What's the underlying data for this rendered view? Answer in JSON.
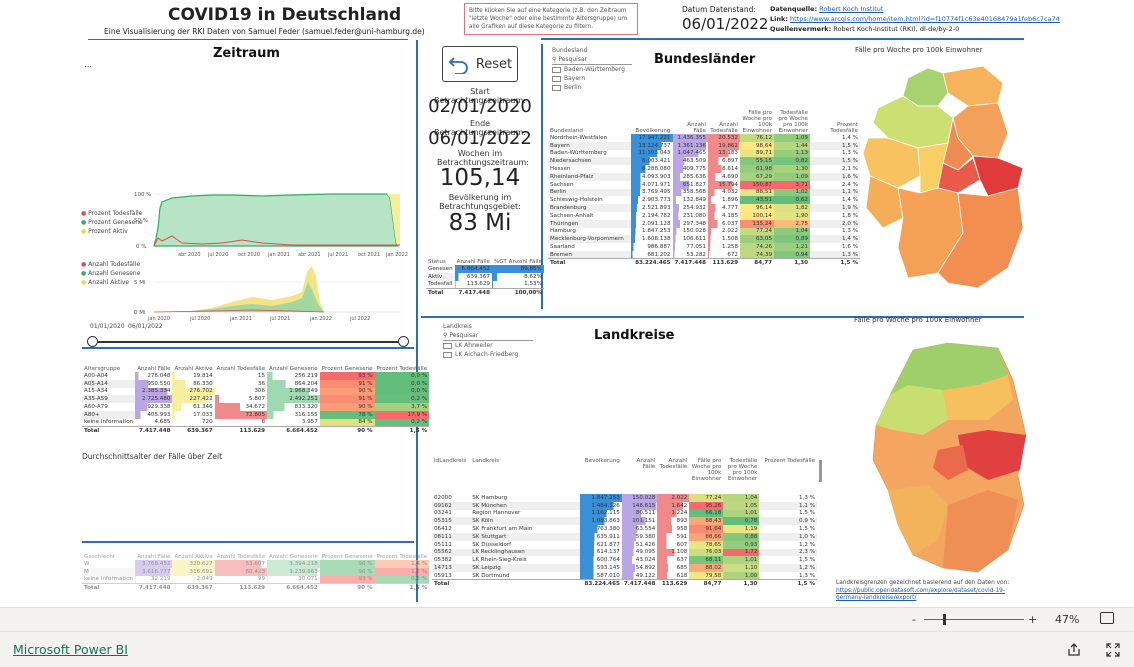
{
  "header": {
    "title": "COVID19 in Deutschland",
    "subtitle": "Eine Visualisierung der RKI Daten von Samuel Feder (samuel.feder@uni-hamburg.de)",
    "notice": "Bitte klicken Sie auf eine Kategorie (z.B. den Zeitraum \"letzte Woche\" oder eine bestimmte Altersgruppe) um alle Grafiken auf diese Kategorie zu filtern.",
    "datenstand_label": "Datum Datenstand:",
    "datenstand_value": "06/01/2022",
    "quelle_label": "Datenquelle:",
    "quelle_value": "Robert Koch Institut",
    "link_label": "Link:",
    "link_value": "https://www.arcgis.com/home/item.html?id=f10774f1c63e40168479a1feb6c7ca74",
    "vermerk_label": "Quellenvermerk:",
    "vermerk_value": "Robert Koch-Institut (RKI), dl-de/by-2-0"
  },
  "zeitraum": {
    "title": "Zeitraum",
    "legend1": [
      "Prozent Todesfälle",
      "Prozent Genesene",
      "Prozent Aktiv"
    ],
    "legend2": [
      "Anzahl Todesfälle",
      "Anzahl Genesene",
      "Anzahl Aktive"
    ],
    "chart1_yticks": [
      "100 %",
      "50 %",
      "0 %"
    ],
    "chart1_xticks": [
      "abr 2020",
      "jul 2020",
      "oct 2020",
      "jan 2021",
      "abr 2021",
      "jul 2021",
      "oct 2021",
      "jan 2022"
    ],
    "chart2_yticks": [
      "5 Mi",
      "0 Mi"
    ],
    "chart2_xticks": [
      "jan 2020",
      "jul 2020",
      "jan 2021",
      "jul 2021",
      "jan 2022",
      "jul 2022"
    ],
    "slider_start": "01/01/2020",
    "slider_end": "06/01/2022",
    "avg_age_title": "Durchschnittsalter der Fälle über Zeit"
  },
  "controls": {
    "reset_label": "Reset",
    "start_label": "Start Betrachtungszeitraum:",
    "start_value": "02/01/2020",
    "end_label": "Ende Betrachtungszeitraum:",
    "end_value": "06/01/2022",
    "weeks_label": "Wochen im Betrachtungszeitraum:",
    "weeks_value": "105,14",
    "pop_label": "Bevölkerung im Betrachtungsgebiet:",
    "pop_value": "83 Mi"
  },
  "status_table": {
    "headers": [
      "Status",
      "Anzahl Fälle",
      "%GT Anzahl Fälle"
    ],
    "rows": [
      [
        "Genesen",
        "6.664.452",
        "89,85%"
      ],
      [
        "Aktiv",
        "639.367",
        "8,62%"
      ],
      [
        "Todesfall",
        "113.629",
        "1,53%"
      ]
    ],
    "total": [
      "Total",
      "7.417.448",
      "100,00%"
    ]
  },
  "alter_table": {
    "headers": [
      "Altersgruppe",
      "Anzahl Fälle",
      "Anzahl Aktive",
      "Anzahl Todesfälle",
      "Anzahl Genesene",
      "Prozent Genesene",
      "Prozent Todesfälle"
    ],
    "rows": [
      [
        "A00-A04",
        "276.048",
        "19.814",
        "15",
        "256.219",
        "93 %",
        "0,0 %"
      ],
      [
        "A05-A14",
        "950.550",
        "86.330",
        "36",
        "864.204",
        "91 %",
        "0,0 %"
      ],
      [
        "A15-A34",
        "2.385.334",
        "276.702",
        "306",
        "1.968.349",
        "90 %",
        "0,0 %"
      ],
      [
        "A35-A59",
        "2.725.480",
        "227.422",
        "5.807",
        "2.492.251",
        "91 %",
        "0,2 %"
      ],
      [
        "A60-A79",
        "929.338",
        "61.346",
        "34.672",
        "833.320",
        "90 %",
        "3,7 %"
      ],
      [
        "A80+",
        "405.993",
        "17.033",
        "72.805",
        "316.155",
        "78 %",
        "17,9 %"
      ],
      [
        "keine Information",
        "4.685",
        "720",
        "8",
        "3.957",
        "84 %",
        "0,2 %"
      ]
    ],
    "total": [
      "Total",
      "7.417.448",
      "639.367",
      "113.629",
      "6.664.452",
      "90 %",
      "1,5 %"
    ]
  },
  "geschlecht_table": {
    "headers": [
      "Geschlecht",
      "Anzahl Fälle",
      "Anzahl Aktive",
      "Anzahl Todesfälle",
      "Anzahl Genesene",
      "Prozent Genesene",
      "Prozent Todesfälle"
    ],
    "rows": [
      [
        "W",
        "3.768.452",
        "320.627",
        "53.607",
        "3.394.218",
        "90 %",
        "1,4 %"
      ],
      [
        "M",
        "3.616.777",
        "316.691",
        "60.423",
        "3.239.663",
        "90 %",
        "1,7 %"
      ],
      [
        "keine Information",
        "32.219",
        "2.049",
        "99",
        "30.071",
        "93 %",
        "0,3 %"
      ]
    ],
    "total": [
      "Total",
      "7.417.448",
      "639.367",
      "113.629",
      "6.664.452",
      "90 %",
      "1,5 %"
    ]
  },
  "bundeslaender": {
    "title": "Bundesländer",
    "slicer_label": "Bundesland",
    "slicer_search": "Pesquisar",
    "slicer_items": [
      "Baden-Württemberg",
      "Bayern",
      "Berlin"
    ],
    "map_title": "Fälle pro Woche pro 100k Einwohner",
    "headers": [
      "Bundesland",
      "Bevölkerung",
      "Anzahl Fälle",
      "Anzahl Todesfälle",
      "Fälle pro Woche pro 100k Einwohner",
      "Todesfälle pro Woche pro 100k Einwohner",
      "Prozent Todesfälle"
    ],
    "rows": [
      [
        "Nordrhein-Westfalen",
        "17.947.221",
        "1.436.355",
        "20.532",
        "76,12",
        "1,09",
        "1,4 %"
      ],
      [
        "Bayern",
        "13.124.737",
        "1.361.136",
        "19.862",
        "98,64",
        "1,44",
        "1,5 %"
      ],
      [
        "Baden-Württemberg",
        "11.103.043",
        "1.047.465",
        "13.183",
        "89,71",
        "1,13",
        "1,3 %"
      ],
      [
        "Niedersachsen",
        "8.003.421",
        "463.509",
        "6.897",
        "55,15",
        "0,82",
        "1,5 %"
      ],
      [
        "Hessen",
        "6.288.080",
        "409.775",
        "8.614",
        "61,98",
        "1,30",
        "2,1 %"
      ],
      [
        "Rheinland-Pfalz",
        "4.093.903",
        "285.636",
        "4.690",
        "67,29",
        "1,09",
        "1,6 %"
      ],
      [
        "Sachsen",
        "4.071.971",
        "651.827",
        "15.794",
        "150,87",
        "3,71",
        "2,4 %"
      ],
      [
        "Berlin",
        "3.769.495",
        "358.568",
        "4.032",
        "88,51",
        "1,02",
        "1,1 %"
      ],
      [
        "Schleswig-Holstein",
        "2.903.773",
        "132.849",
        "1.896",
        "43,51",
        "0,62",
        "1,4 %"
      ],
      [
        "Brandenburg",
        "2.521.893",
        "254.932",
        "4.777",
        "96,14",
        "1,82",
        "1,9 %"
      ],
      [
        "Sachsen-Anhalt",
        "2.194.782",
        "231.080",
        "4.185",
        "100,14",
        "1,90",
        "1,8 %"
      ],
      [
        "Thüringen",
        "2.091.128",
        "297.348",
        "6.037",
        "135,24",
        "2,75",
        "2,0 %"
      ],
      [
        "Hamburg",
        "1.847.253",
        "150.028",
        "2.022",
        "77,24",
        "1,04",
        "1,3 %"
      ],
      [
        "Mecklenburg-Vorpommern",
        "1.608.138",
        "106.611",
        "1.508",
        "63,05",
        "0,89",
        "1,4 %"
      ],
      [
        "Saarland",
        "986.887",
        "77.051",
        "1.258",
        "74,26",
        "1,21",
        "1,6 %"
      ],
      [
        "Bremen",
        "681.202",
        "53.282",
        "672",
        "74,39",
        "0,94",
        "1,3 %"
      ]
    ],
    "total": [
      "Total",
      "83.224.465",
      "7.417.448",
      "113.629",
      "84,77",
      "1,30",
      "1,5 %"
    ]
  },
  "landkreise": {
    "title": "Landkreise",
    "slicer_label": "Landkreis",
    "slicer_search": "Pesquisar",
    "slicer_items": [
      "LK Ahrweiler",
      "LK Aichach-Friedberg"
    ],
    "map_title": "Fälle pro Woche pro 100k Einwohner",
    "map_note": "Landkreisgrenzen gezeichnet basierend auf den Daten von:",
    "map_link": "https://public.opendatasoft.com/explore/dataset/covid-19-germany-landkreise/export/",
    "headers": [
      "IdLandkreis",
      "Landkreis",
      "Bevölkerung",
      "Anzahl Fälle",
      "Anzahl Todesfälle",
      "Fälle pro Woche pro 100k Einwohner",
      "Todesfälle pro Woche pro 100k Einwohner",
      "Prozent Todesfälle"
    ],
    "rows": [
      [
        "02000",
        "SK Hamburg",
        "1.847.253",
        "150.028",
        "2.022",
        "77,24",
        "1,04",
        "1,3 %"
      ],
      [
        "09162",
        "SK München",
        "1.484.226",
        "148.615",
        "1.642",
        "95,26",
        "1,05",
        "1,1 %"
      ],
      [
        "03241",
        "Region Hannover",
        "1.162.115",
        "80.511",
        "1.224",
        "66,18",
        "1,01",
        "1,5 %"
      ],
      [
        "05315",
        "SK Köln",
        "1.083.863",
        "101.151",
        "893",
        "88,43",
        "0,78",
        "0,9 %"
      ],
      [
        "06412",
        "SK Frankfurt am Main",
        "763.380",
        "63.554",
        "958",
        "91,64",
        "1,19",
        "1,5 %"
      ],
      [
        "08111",
        "SK Stuttgart",
        "635.911",
        "59.380",
        "591",
        "88,66",
        "0,88",
        "1,0 %"
      ],
      [
        "05111",
        "SK Düsseldorf",
        "621.877",
        "51.426",
        "607",
        "78,65",
        "0,93",
        "1,2 %"
      ],
      [
        "05562",
        "LK Recklinghausen",
        "614.137",
        "49.095",
        "1.108",
        "76,03",
        "1,72",
        "2,3 %"
      ],
      [
        "05382",
        "LK Rhein-Sieg-Kreis",
        "600.764",
        "43.024",
        "637",
        "68,11",
        "1,01",
        "1,5 %"
      ],
      [
        "14713",
        "SK Leipzig",
        "593.145",
        "54.892",
        "685",
        "88,02",
        "1,10",
        "1,2 %"
      ],
      [
        "05913",
        "SK Dortmund",
        "587.010",
        "49.122",
        "618",
        "79,58",
        "1,00",
        "1,3 %"
      ]
    ],
    "total": [
      "Total",
      "",
      "83.224.465",
      "7.417.448",
      "113.629",
      "84,77",
      "1,30",
      "1,5 %"
    ]
  },
  "footer": {
    "brand": "Microsoft Power BI",
    "zoom_minus": "-",
    "zoom_plus": "+",
    "zoom_value": "47%",
    "zoom_level": 0.47
  },
  "colors": {
    "accent": "#2a6fb5",
    "blue_bar": "#3a8fd9",
    "purple_bar": "#b9a6e3",
    "red_bar": "#f08a8a",
    "genesen": "#2fae64",
    "aktiv": "#f0e06a",
    "tod": "#e14b4b"
  }
}
